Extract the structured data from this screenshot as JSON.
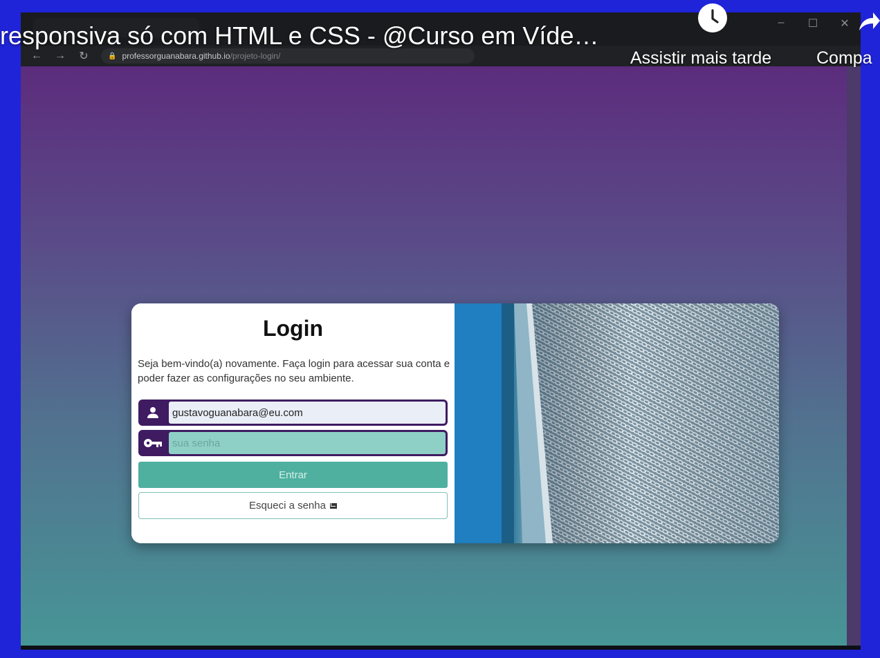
{
  "video_overlay": {
    "title": "responsiva só com HTML e CSS - @Curso em Víde…",
    "watch_later_label": "Assistir mais tarde",
    "share_label": "Compa"
  },
  "browser": {
    "url_host": "professorguanabara.github.io",
    "url_path": "/projeto-login/"
  },
  "login": {
    "title": "Login",
    "welcome_text": "Seja bem-vindo(a) novamente. Faça login para acessar sua conta e poder fazer as configurações no seu ambiente.",
    "email_value": "gustavoguanabara@eu.com",
    "password_placeholder": "sua senha",
    "submit_label": "Entrar",
    "forgot_label": "Esqueci a senha"
  },
  "colors": {
    "frame_blue": "#1f24d9",
    "purple": "#3f1b62",
    "teal": "#4fb09f"
  }
}
